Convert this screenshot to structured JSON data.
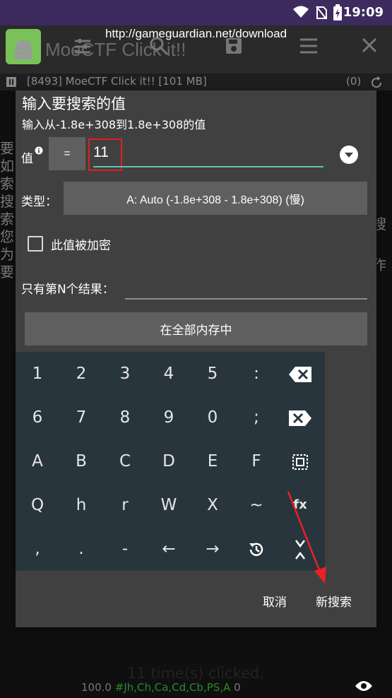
{
  "status_bar": {
    "time": "19:09"
  },
  "url_banner": "http://gameguardian.net/download",
  "app_bar": {
    "title": "MoeCTF Click it!!"
  },
  "process_bar": {
    "text": "[8493] MoeCTF Click it!! [101 MB]",
    "count": "(0)"
  },
  "background_text": {
    "left_column": [
      "要",
      "如",
      "索",
      "搜",
      "索",
      "您",
      "为",
      "要"
    ],
    "right_column": [
      "搜",
      "作"
    ]
  },
  "dialog": {
    "title": "输入要搜索的值",
    "subtitle": "输入从-1.8e+308到1.8e+308的值",
    "value_label": "值",
    "operator": "=",
    "value_input": "11",
    "type_label": "类型：",
    "type_value": "A: Auto (-1.8e+308 - 1.8e+308) (慢)",
    "encrypted_label": "此值被加密",
    "nth_label": "只有第N个结果：",
    "memory_button": "在全部内存中",
    "cancel_button": "取消",
    "new_search_button": "新搜索"
  },
  "keyboard": {
    "rows": [
      [
        "1",
        "2",
        "3",
        "4",
        "5",
        ":",
        "backspace"
      ],
      [
        "6",
        "7",
        "8",
        "9",
        "0",
        ";",
        "clear"
      ],
      [
        "A",
        "B",
        "C",
        "D",
        "E",
        "F",
        "select-all"
      ],
      [
        "Q",
        "h",
        "r",
        "W",
        "X",
        "~",
        "fx"
      ],
      [
        ",",
        ".",
        "-",
        "←",
        "→",
        "history",
        "collapse"
      ]
    ],
    "fx_label": "fx"
  },
  "background_status": {
    "clicks": "11 time(s) clicked.",
    "line_prefix": "100.0",
    "line_hash": "#",
    "line_suffix": "Jh,Ch,Ca,Cd,Cb,PS,A",
    "line_count": "0"
  },
  "colors": {
    "input_underline": "#5fc4b4",
    "highlight_box": "#e02020",
    "arrow": "#e8202a",
    "keyboard_bg": "#29353d",
    "dialog_bg": "#404040"
  }
}
